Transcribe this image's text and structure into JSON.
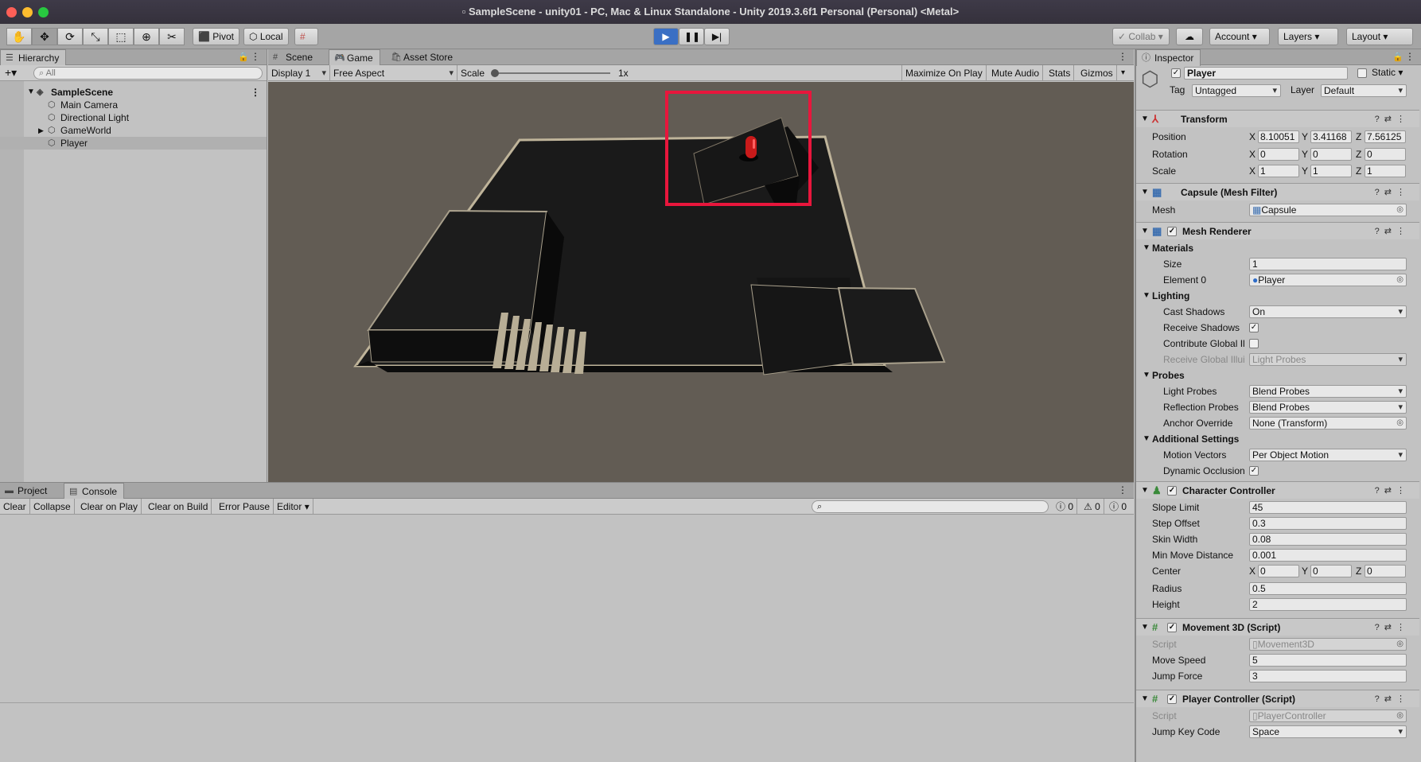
{
  "window": {
    "title": "SampleScene - unity01 - PC, Mac & Linux Standalone - Unity 2019.3.6f1 Personal (Personal) <Metal>"
  },
  "toolbar": {
    "pivot": "Pivot",
    "local": "Local",
    "collab": "Collab",
    "account": "Account",
    "layers": "Layers",
    "layout": "Layout"
  },
  "hierarchy": {
    "tab": "Hierarchy",
    "search_placeholder": "All",
    "scene": "SampleScene",
    "items": [
      "Main Camera",
      "Directional Light",
      "GameWorld",
      "Player"
    ]
  },
  "game": {
    "tabs": [
      "Scene",
      "Game",
      "Asset Store"
    ],
    "display": "Display 1",
    "aspect": "Free Aspect",
    "scale_label": "Scale",
    "scale_value": "1x",
    "maximize": "Maximize On Play",
    "mute": "Mute Audio",
    "stats": "Stats",
    "gizmos": "Gizmos"
  },
  "console": {
    "tabs": [
      "Project",
      "Console"
    ],
    "buttons": [
      "Clear",
      "Collapse",
      "Clear on Play",
      "Clear on Build",
      "Error Pause",
      "Editor"
    ],
    "counts": [
      "0",
      "0",
      "0"
    ]
  },
  "inspector": {
    "tab": "Inspector",
    "object_name": "Player",
    "static_label": "Static",
    "tag_label": "Tag",
    "tag_value": "Untagged",
    "layer_label": "Layer",
    "layer_value": "Default",
    "transform": {
      "title": "Transform",
      "position_label": "Position",
      "position": [
        "8.10051",
        "3.41168",
        "7.56125"
      ],
      "rotation_label": "Rotation",
      "rotation": [
        "0",
        "0",
        "0"
      ],
      "scale_label": "Scale",
      "scale": [
        "1",
        "1",
        "1"
      ]
    },
    "mesh_filter": {
      "title": "Capsule (Mesh Filter)",
      "mesh_label": "Mesh",
      "mesh": "Capsule"
    },
    "mesh_renderer": {
      "title": "Mesh Renderer",
      "materials": "Materials",
      "size_label": "Size",
      "size": "1",
      "element_label": "Element 0",
      "element": "Player",
      "lighting": "Lighting",
      "cast_label": "Cast Shadows",
      "cast": "On",
      "receive_label": "Receive Shadows",
      "contribute_label": "Contribute Global Il",
      "receive_gi_label": "Receive Global Illui",
      "receive_gi": "Light Probes",
      "probes": "Probes",
      "light_probes_label": "Light Probes",
      "light_probes": "Blend Probes",
      "reflection_label": "Reflection Probes",
      "reflection": "Blend Probes",
      "anchor_label": "Anchor Override",
      "anchor": "None (Transform)",
      "additional": "Additional Settings",
      "motion_label": "Motion Vectors",
      "motion": "Per Object Motion",
      "dynamic_label": "Dynamic Occlusion"
    },
    "character_controller": {
      "title": "Character Controller",
      "slope_label": "Slope Limit",
      "slope": "45",
      "step_label": "Step Offset",
      "step": "0.3",
      "skin_label": "Skin Width",
      "skin": "0.08",
      "minmove_label": "Min Move Distance",
      "minmove": "0.001",
      "center_label": "Center",
      "center": [
        "0",
        "0",
        "0"
      ],
      "radius_label": "Radius",
      "radius": "0.5",
      "height_label": "Height",
      "height": "2"
    },
    "movement": {
      "title": "Movement 3D (Script)",
      "script_label": "Script",
      "script": "Movement3D",
      "speed_label": "Move Speed",
      "speed": "5",
      "jump_label": "Jump Force",
      "jump": "3"
    },
    "player_controller": {
      "title": "Player Controller (Script)",
      "script_label": "Script",
      "script": "PlayerController",
      "key_label": "Jump Key Code",
      "key": "Space"
    }
  },
  "colors": {
    "highlight_box": "#e8163c",
    "viewport_bg": "#625c54",
    "play_active": "#3a6fc4"
  }
}
